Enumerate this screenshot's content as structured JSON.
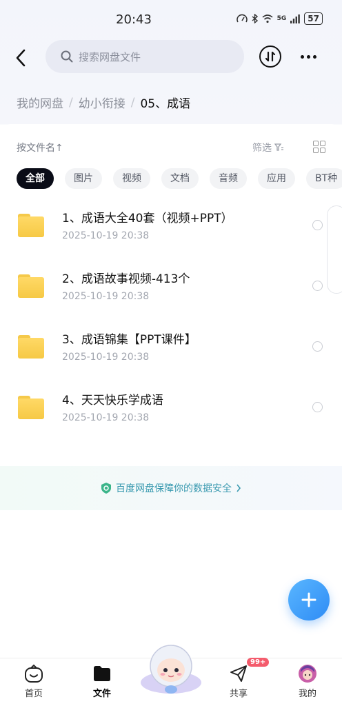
{
  "status_bar": {
    "time": "20:43",
    "network": "5G",
    "battery": "57"
  },
  "header": {
    "search_placeholder": "搜索网盘文件"
  },
  "breadcrumb": {
    "items": [
      "我的网盘",
      "幼小衔接"
    ],
    "current": "05、成语",
    "separator": "/"
  },
  "toolbar": {
    "sort_label": "按文件名↑",
    "filter_label": "筛选"
  },
  "filter_chips": [
    "全部",
    "图片",
    "视频",
    "文档",
    "音频",
    "应用",
    "BT种"
  ],
  "files": [
    {
      "name": "1、成语大全40套（视频+PPT）",
      "date": "2025-10-19  20:38"
    },
    {
      "name": "2、成语故事视频-413个",
      "date": "2025-10-19  20:38"
    },
    {
      "name": "3、成语锦集【PPT课件】",
      "date": "2025-10-19  20:38"
    },
    {
      "name": "4、天天快乐学成语",
      "date": "2025-10-19  20:38"
    }
  ],
  "security_banner": "百度网盘保障你的数据安全",
  "bottom_nav": {
    "home": "首页",
    "files": "文件",
    "share": "共享",
    "mine": "我的",
    "share_badge": "99+"
  },
  "colors": {
    "accent": "#2f8cf5",
    "chip_active": "#0a0c17",
    "folder": "#f6c945",
    "badge": "#f45b6c"
  }
}
